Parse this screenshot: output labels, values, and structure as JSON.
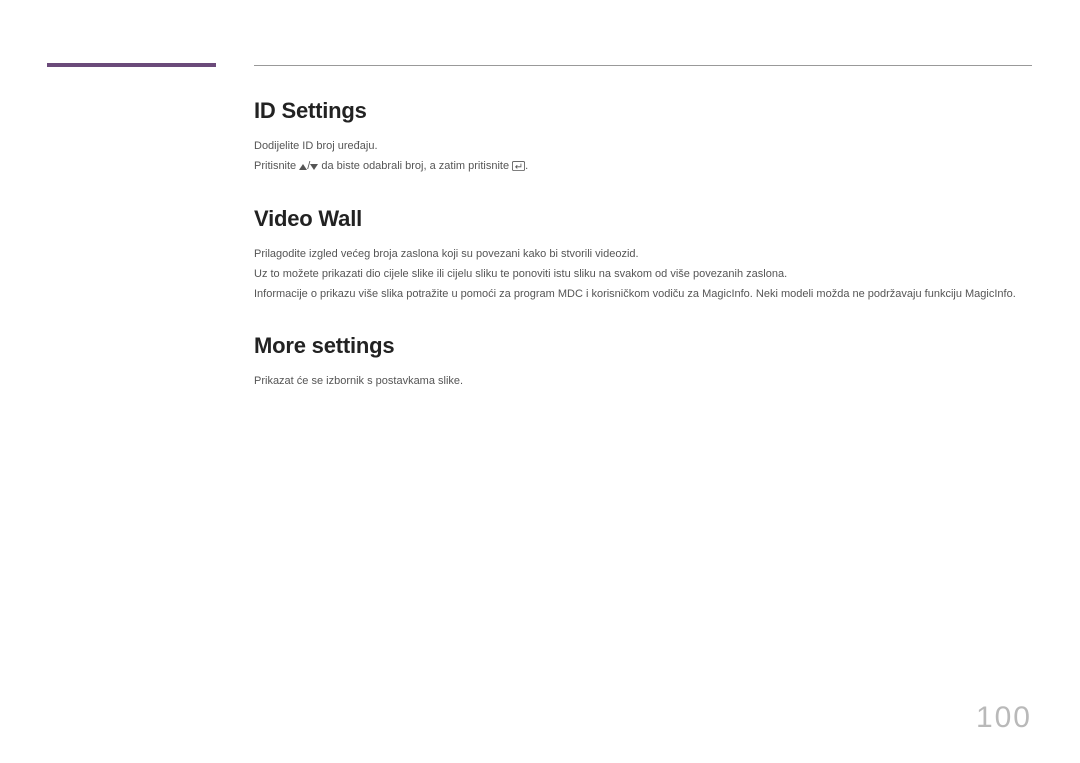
{
  "sections": {
    "id_settings": {
      "heading": "ID Settings",
      "line1": "Dodijelite ID broj uređaju.",
      "line2_pre": "Pritisnite ",
      "line2_mid": " da biste odabrali broj, a zatim pritisnite ",
      "line2_post": "."
    },
    "video_wall": {
      "heading": "Video Wall",
      "line1": "Prilagodite izgled većeg broja zaslona koji su povezani kako bi stvorili videozid.",
      "line2": "Uz to možete prikazati dio cijele slike ili cijelu sliku te ponoviti istu sliku na svakom od više povezanih zaslona.",
      "line3": "Informacije o prikazu više slika potražite u pomoći za program MDC i korisničkom vodiču za MagicInfo. Neki modeli možda ne podržavaju funkciju MagicInfo."
    },
    "more_settings": {
      "heading": "More settings",
      "line1": "Prikazat će se izbornik s postavkama slike."
    }
  },
  "page_number": "100"
}
